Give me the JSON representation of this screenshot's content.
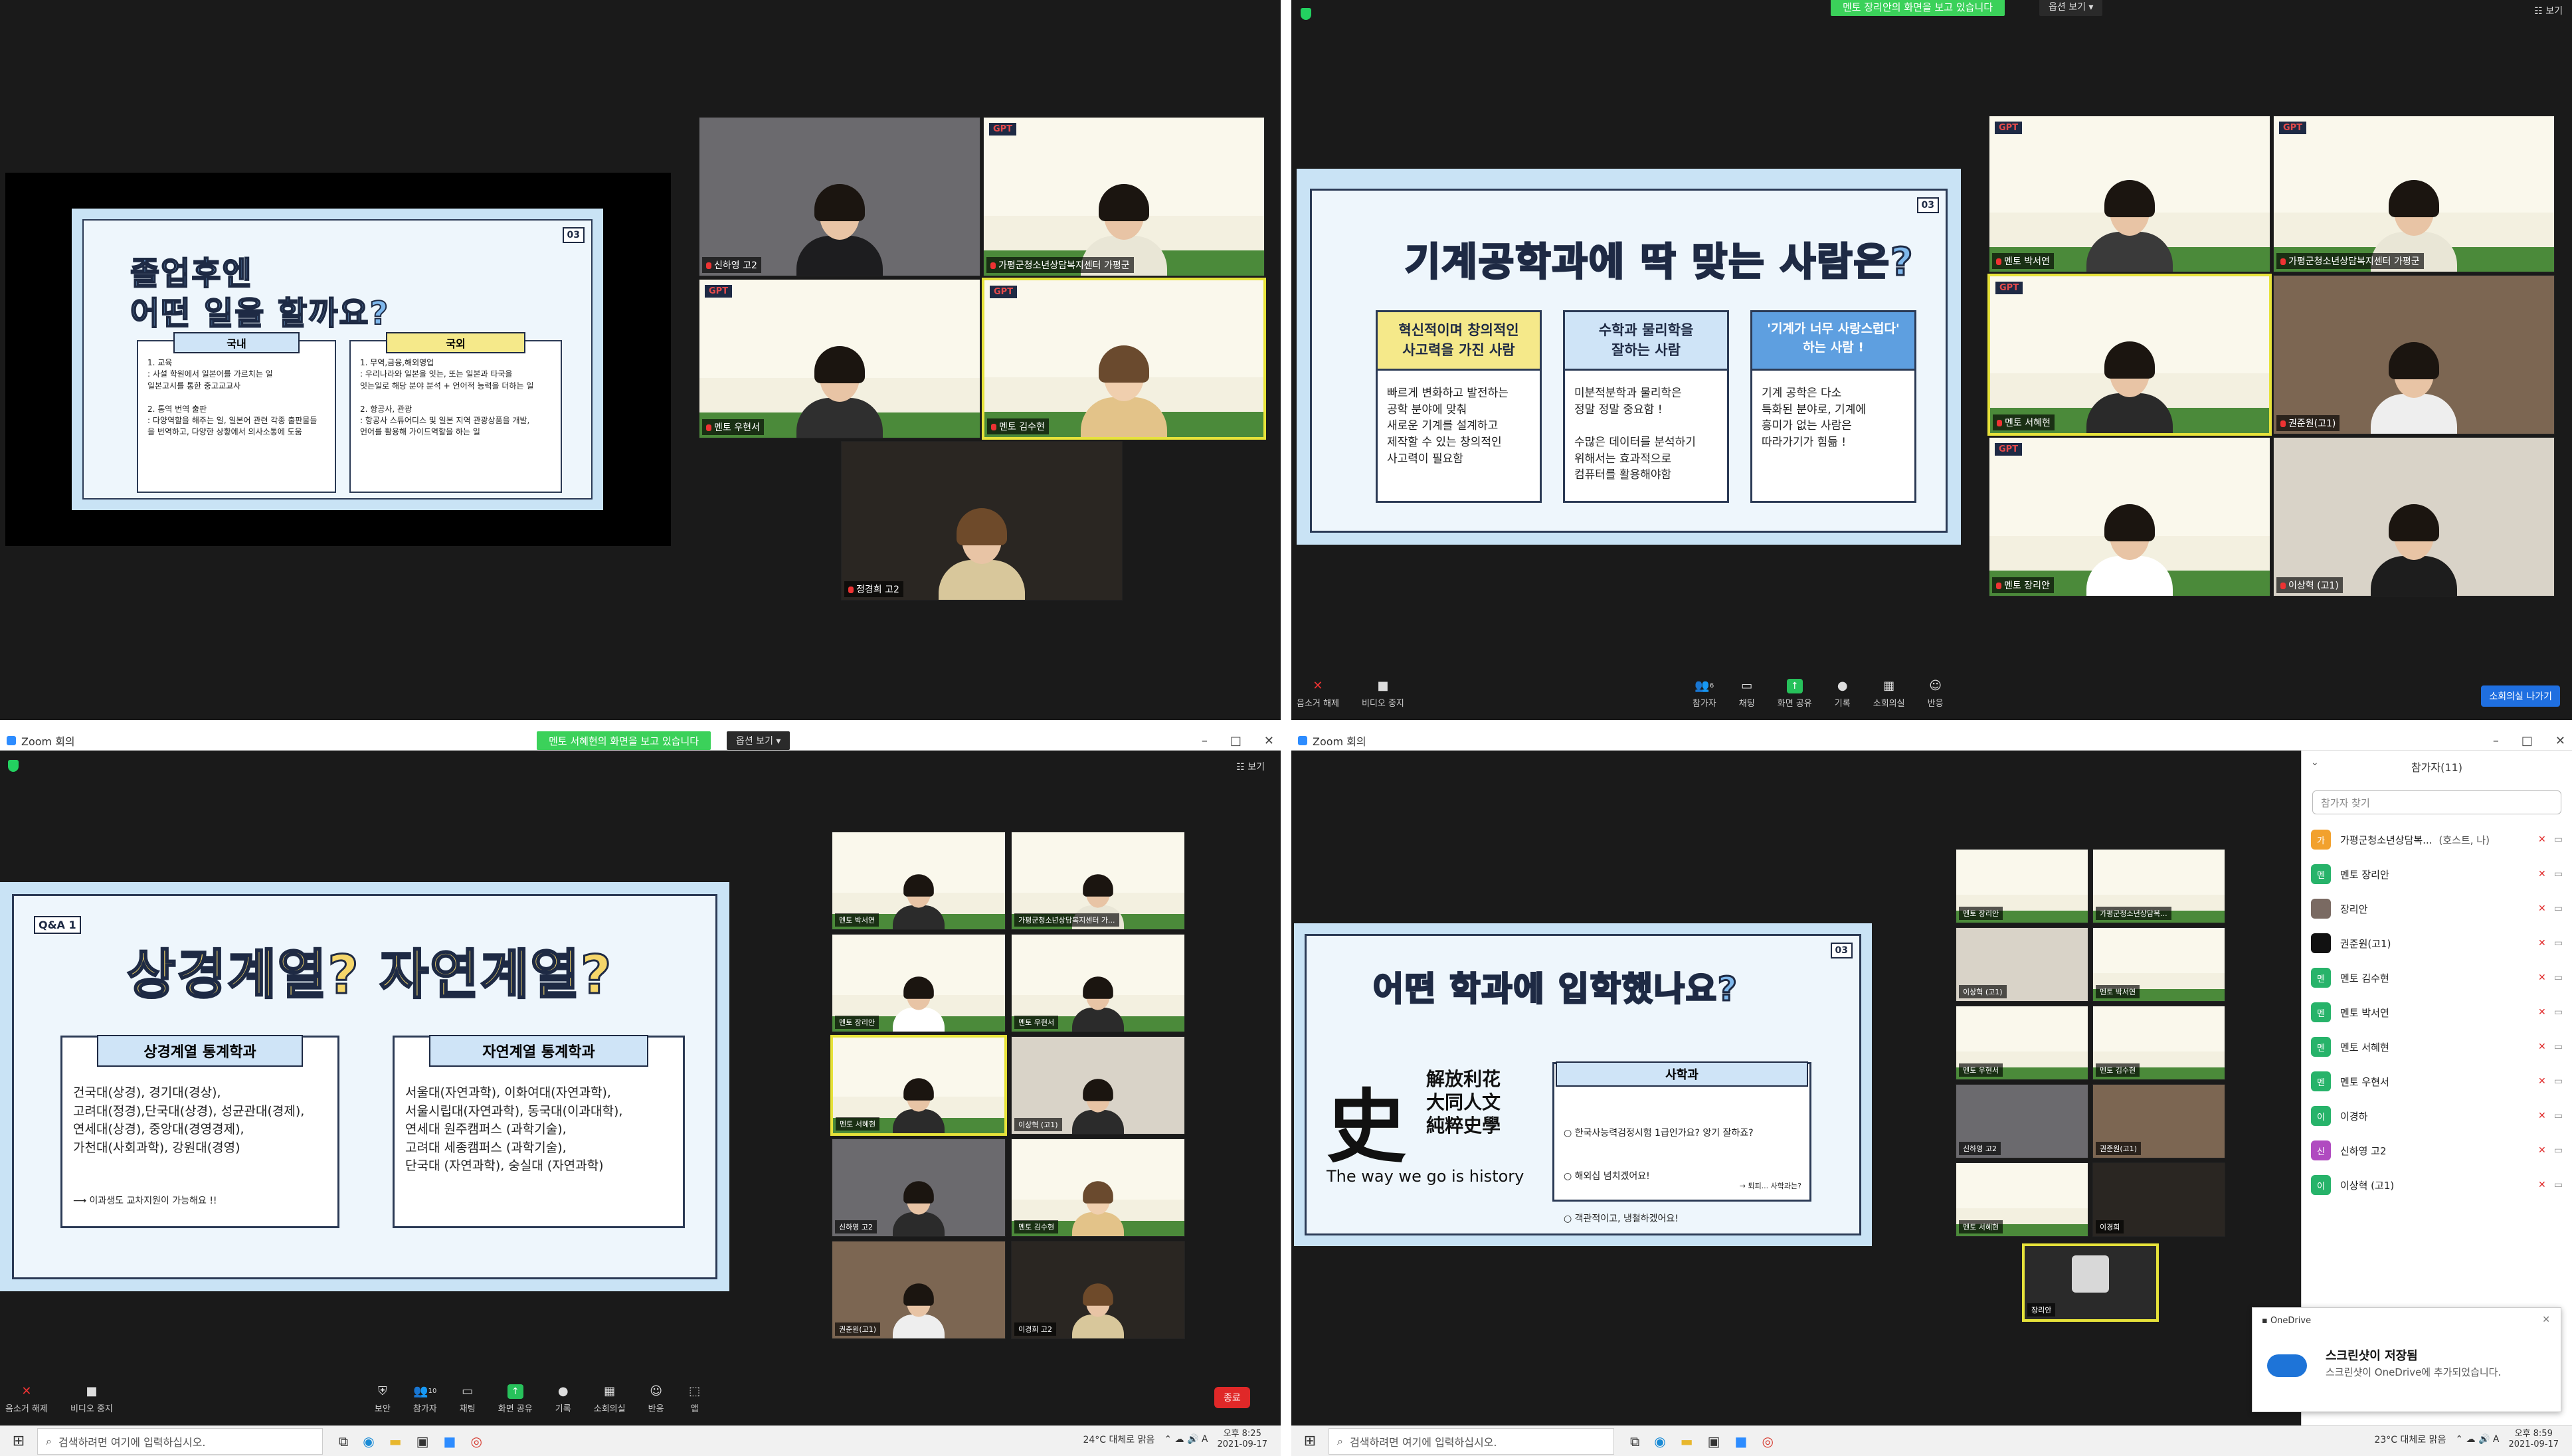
{
  "q1": {
    "slide": {
      "title_line1": "졸업후엔",
      "title_line2": "어떤 일을 할까요?",
      "left_head": "국내",
      "left_text": "1. 교육\n: 사설 학원에서 일본어를 가르치는 일\n일본고시를 통한 중고교교사\n\n2. 통역 번역 출판\n: 다양역할을 해주는 일, 일본어 관련 각종 출판물들\n을 번역하고, 다양한 상황에서 의사소통에 도움",
      "right_head": "국외",
      "right_text": "1. 무역,금융,해외영업\n: 우리나라와 일본을 잇는, 또는 일본과 타국을\n잇는일로 해당 분야 분석 + 언어적 능력을 더하는 일\n\n2. 항공사, 관광\n: 항공사 스튜어디스 및 일본 지역 관광상품을 개발,\n언어를 활용해 가이드역할을 하는 일",
      "page": "03"
    },
    "tiles": [
      {
        "name": "신하영 고2"
      },
      {
        "name": "가평군청소년상담복지센터 가평군"
      },
      {
        "name": "멘토 우현서"
      },
      {
        "name": "멘토 김수현"
      },
      {
        "name": "정경희 고2"
      }
    ]
  },
  "q2": {
    "banner": "멘토 장리안의 화면을 보고 있습니다",
    "view_options": "옵션 보기 ▾",
    "view_label": "보기",
    "slide": {
      "title": "기계공학과에 딱 맞는 사람은?",
      "page": "03",
      "boxes": [
        {
          "head": "혁신적이며 창의적인\n사고력을 가진 사람",
          "text": "빠르게 변화하고 발전하는\n공학 분야에 맞춰\n새로운 기계를 설계하고\n제작할 수 있는 창의적인\n사고력이 필요함"
        },
        {
          "head": "수학과 물리학을\n잘하는 사람",
          "text": "미분적분학과 물리학은\n정말 정말 중요함 !\n\n수많은 데이터를 분석하기\n위해서는 효과적으로\n컴퓨터를 활용해야함"
        },
        {
          "head": "'기계가 너무 사랑스럽다'\n하는 사람 !",
          "text": "기계 공학은 다소\n특화된 분야로, 기계에\n흥미가 없는 사람은\n따라가기가 힘듦 !"
        }
      ]
    },
    "tiles": [
      {
        "name": "멘토 박서연"
      },
      {
        "name": "가평군청소년상담복지센터 가평군"
      },
      {
        "name": "멘토 서혜현"
      },
      {
        "name": "권준원(고1)"
      },
      {
        "name": "멘토 장리안"
      },
      {
        "name": "이상혁 (고1)"
      }
    ],
    "toolbar": {
      "mute": "음소거 해제",
      "video": "비디오 중지",
      "participants": "참가자",
      "participants_count": "6",
      "chat": "채팅",
      "share": "화면 공유",
      "record": "기록",
      "rooms": "소회의실",
      "react": "반응",
      "leave": "소회의실 나가기"
    }
  },
  "q3": {
    "app_title": "Zoom 회의",
    "banner": "멘토 서혜현의 화면을 보고 있습니다",
    "view_options": "옵션 보기 ▾",
    "view_label": "보기",
    "slide": {
      "tag": "Q&A 1",
      "title": "상경계열? 자연계열?",
      "left_head": "상경계열 통계학과",
      "left_text": "건국대(상경), 경기대(경상),\n고려대(정경),단국대(상경), 성균관대(경제),\n연세대(상경), 중앙대(경영경제),\n가천대(사회과학), 강원대(경영)",
      "left_note": "이과생도 교차지원이 가능해요 !!",
      "right_head": "자연계열 통계학과",
      "right_text": "서울대(자연과학), 이화여대(자연과학),\n서울시립대(자연과학), 동국대(이과대학),\n연세대 원주캠퍼스 (과학기술),\n고려대 세종캠퍼스 (과학기술),\n단국대 (자연과학), 숭실대 (자연과학)"
    },
    "tiles": [
      {
        "name": "멘토 박서연"
      },
      {
        "name": "가평군청소년상담복지센터 가..."
      },
      {
        "name": "멘토 장리안"
      },
      {
        "name": "멘토 우현서"
      },
      {
        "name": "멘토 서혜현"
      },
      {
        "name": "이상혁 (고1)"
      },
      {
        "name": "신하영 고2"
      },
      {
        "name": "멘토 김수현"
      },
      {
        "name": "권준원(고1)"
      },
      {
        "name": "이경희 고2"
      }
    ],
    "toolbar": {
      "mute": "음소거 해제",
      "video": "비디오 중지",
      "security": "보안",
      "participants": "참가자",
      "participants_count": "10",
      "chat": "채팅",
      "share": "화면 공유",
      "record": "기록",
      "rooms": "소회의실",
      "react": "반응",
      "apps": "앱",
      "end": "종료"
    },
    "taskbar": {
      "search": "검색하려면 여기에 입력하십시오.",
      "weather": "24°C 대체로 맑음",
      "time": "오후 8:25",
      "date": "2021-09-17"
    }
  },
  "q4": {
    "app_title": "Zoom 회의",
    "slide": {
      "title": "어떤 학과에 입학했나요?",
      "page": "03",
      "logo_char": "史",
      "logo_lines": [
        "解放利花",
        "大同人文",
        "純粹史學"
      ],
      "logo_en": "The way we go is history",
      "box_head": "사학과",
      "box_items": [
        "한국사능력검정시험 1급인가요? 앙기 잘하죠?",
        "해외십 넘치겠어요!",
        "객관적이고, 냉철하겠어요!"
      ],
      "box_note": "→ 퇴피... 사학과는?"
    },
    "tiles": [
      {
        "name": "멘토 장리안"
      },
      {
        "name": "가평군청소년상담복..."
      },
      {
        "name": "이상혁 (고1)"
      },
      {
        "name": "멘토 박서연"
      },
      {
        "name": "멘토 우현서"
      },
      {
        "name": "멘토 김수현"
      },
      {
        "name": "신하영 고2"
      },
      {
        "name": "권준원(고1)"
      },
      {
        "name": "멘토 서혜현"
      },
      {
        "name": "이경희"
      },
      {
        "name": "장리안"
      }
    ],
    "panel": {
      "title": "참가자(11)",
      "search": "참가자 찾기",
      "participants": [
        {
          "avatar": "가",
          "name": "가평군청소년상담복...",
          "note": "(호스트, 나)",
          "color": "#f2a12d"
        },
        {
          "avatar": "멘",
          "name": "멘토 장리안",
          "note": "",
          "color": "#27b36a"
        },
        {
          "avatar": "",
          "name": "장리안",
          "note": "",
          "color": "#7a6a62"
        },
        {
          "avatar": "",
          "name": "권준원(고1)",
          "note": "",
          "color": "#111111"
        },
        {
          "avatar": "멘",
          "name": "멘토 김수현",
          "note": "",
          "color": "#27b36a"
        },
        {
          "avatar": "멘",
          "name": "멘토 박서연",
          "note": "",
          "color": "#27b36a"
        },
        {
          "avatar": "멘",
          "name": "멘토 서혜현",
          "note": "",
          "color": "#27b36a"
        },
        {
          "avatar": "멘",
          "name": "멘토 우현서",
          "note": "",
          "color": "#27b36a"
        },
        {
          "avatar": "이",
          "name": "이경하",
          "note": "",
          "color": "#27b36a"
        },
        {
          "avatar": "신",
          "name": "신하영 고2",
          "note": "",
          "color": "#b04bc0"
        },
        {
          "avatar": "이",
          "name": "이상혁 (고1)",
          "note": "",
          "color": "#27b36a"
        }
      ]
    },
    "toast": {
      "app": "OneDrive",
      "title": "스크린샷이 저장됨",
      "body": "스크린샷이 OneDrive에 추가되었습니다."
    },
    "taskbar": {
      "search": "검색하려면 여기에 입력하십시오.",
      "weather": "23°C 대체로 맑음",
      "time": "오후 8:59",
      "date": "2021-09-17"
    }
  }
}
